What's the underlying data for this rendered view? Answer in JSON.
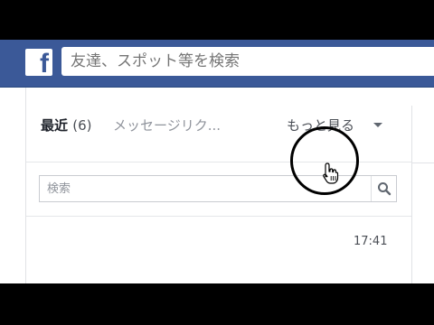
{
  "header": {
    "logo_text": "f",
    "search_placeholder": "友達、スポット等を検索"
  },
  "messages_panel": {
    "tabs": {
      "recent_label": "最近",
      "recent_count": "(6)",
      "requests_label": "メッセージリク...",
      "more_label": "もっと見る"
    },
    "search": {
      "placeholder": "検索"
    },
    "conversation": {
      "timestamp": "17:41"
    }
  },
  "colors": {
    "facebook_blue": "#3b5998",
    "text_dark": "#1d2129",
    "text_muted": "#90949c"
  },
  "icons": [
    "facebook-logo",
    "search-icon",
    "caret-down-icon",
    "hand-pointer-icon"
  ]
}
